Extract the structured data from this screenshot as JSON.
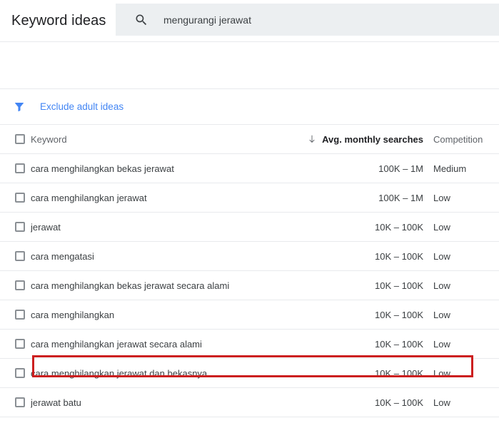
{
  "header": {
    "title": "Keyword ideas",
    "search": {
      "icon": "search-icon",
      "value": "mengurangi jerawat",
      "placeholder": "mengurangi jerawat"
    }
  },
  "filter_bar": {
    "icon": "filter-funnel-icon",
    "label": "Exclude adult ideas",
    "label_color": "#4285f4",
    "icon_color": "#4285f4"
  },
  "table": {
    "columns": {
      "keyword": "Keyword",
      "avg_monthly_searches": "Avg. monthly searches",
      "competition": "Competition"
    },
    "sort": {
      "column": "Avg. monthly searches",
      "direction": "descending",
      "icon": "arrow-down-icon"
    },
    "rows": [
      {
        "keyword": "cara menghilangkan bekas jerawat",
        "avg_monthly_searches": "100K – 1M",
        "competition": "Medium",
        "highlighted": false
      },
      {
        "keyword": "cara menghilangkan jerawat",
        "avg_monthly_searches": "100K – 1M",
        "competition": "Low",
        "highlighted": false
      },
      {
        "keyword": "jerawat",
        "avg_monthly_searches": "10K – 100K",
        "competition": "Low",
        "highlighted": false
      },
      {
        "keyword": "cara mengatasi",
        "avg_monthly_searches": "10K – 100K",
        "competition": "Low",
        "highlighted": false
      },
      {
        "keyword": "cara menghilangkan bekas jerawat secara alami",
        "avg_monthly_searches": "10K – 100K",
        "competition": "Low",
        "highlighted": false
      },
      {
        "keyword": "cara menghilangkan",
        "avg_monthly_searches": "10K – 100K",
        "competition": "Low",
        "highlighted": false
      },
      {
        "keyword": "cara menghilangkan jerawat secara alami",
        "avg_monthly_searches": "10K – 100K",
        "competition": "Low",
        "highlighted": false
      },
      {
        "keyword": "cara menghilangkan jerawat dan bekasnya",
        "avg_monthly_searches": "10K – 100K",
        "competition": "Low",
        "highlighted": true
      },
      {
        "keyword": "jerawat batu",
        "avg_monthly_searches": "10K – 100K",
        "competition": "Low",
        "highlighted": false
      }
    ]
  },
  "annotation": {
    "highlight_color": "#cc1f1f",
    "highlight_row_keyword": "cara menghilangkan jerawat dan bekasnya"
  }
}
